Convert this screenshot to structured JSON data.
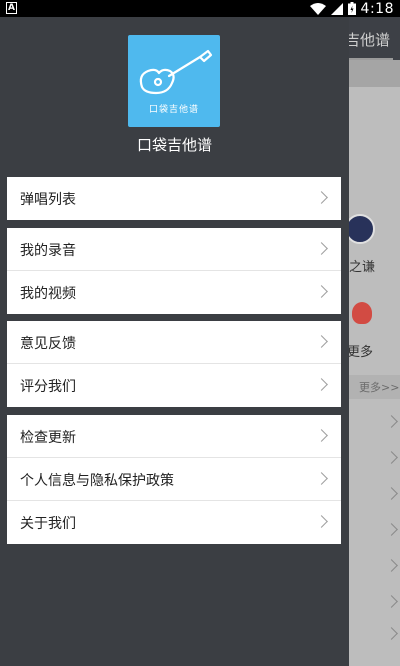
{
  "status_bar": {
    "notification_icon": "A",
    "time": "4:18"
  },
  "drawer": {
    "logo_text": "口袋吉他谱",
    "app_name": "口袋吉他谱",
    "groups": [
      {
        "items": [
          {
            "label": "弹唱列表"
          }
        ]
      },
      {
        "items": [
          {
            "label": "我的录音"
          },
          {
            "label": "我的视频"
          }
        ]
      },
      {
        "items": [
          {
            "label": "意见反馈"
          },
          {
            "label": "评分我们"
          }
        ]
      },
      {
        "items": [
          {
            "label": "检查更新"
          },
          {
            "label": "个人信息与隐私保护政策"
          },
          {
            "label": "关于我们"
          }
        ]
      }
    ]
  },
  "background": {
    "header_fragment": "吉他谱",
    "label_fragment_1": "之谦",
    "label_fragment_2": "更多",
    "more_link": "更多>>"
  },
  "colors": {
    "drawer_bg": "#3b3e43",
    "logo_bg": "#4fb9ee",
    "item_bg": "#ffffff"
  }
}
